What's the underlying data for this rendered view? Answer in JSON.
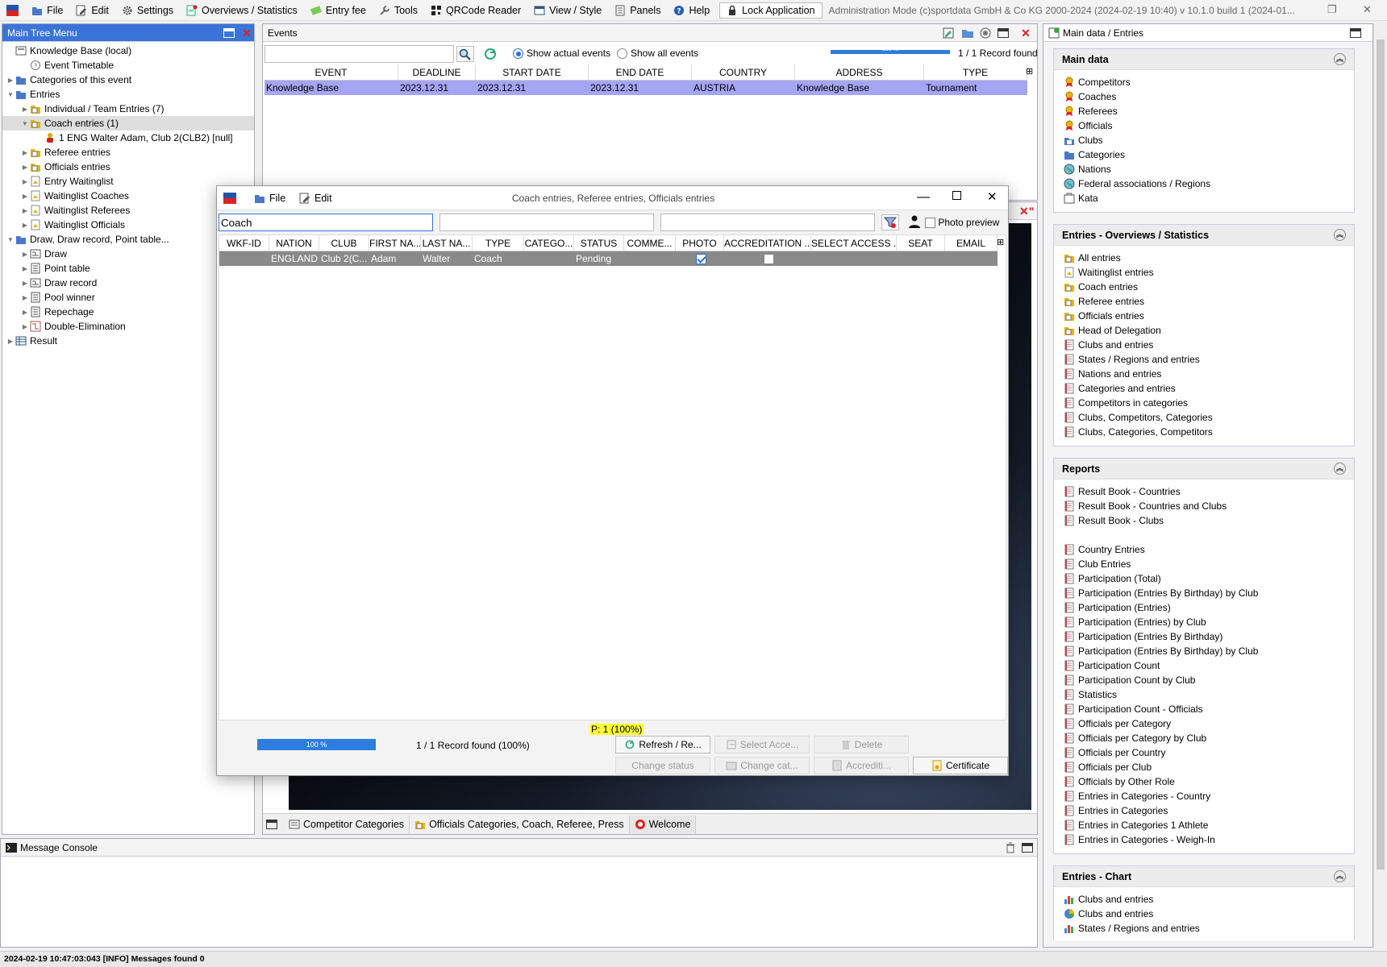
{
  "menubar": {
    "items": [
      {
        "label": "File",
        "icon": "folder-icon"
      },
      {
        "label": "Edit",
        "icon": "edit-icon"
      },
      {
        "label": "Settings",
        "icon": "gear-icon"
      },
      {
        "label": "Overviews / Statistics",
        "icon": "overview-icon"
      },
      {
        "label": "Entry fee",
        "icon": "money-icon"
      },
      {
        "label": "Tools",
        "icon": "tools-icon"
      },
      {
        "label": "QRCode Reader",
        "icon": "qrcode-icon"
      },
      {
        "label": "View / Style",
        "icon": "view-icon"
      },
      {
        "label": "Panels",
        "icon": "panels-icon"
      },
      {
        "label": "Help",
        "icon": "help-icon"
      }
    ],
    "lock_label": "Lock Application",
    "status": "Administration Mode (c)sportdata GmbH & Co KG 2000-2024 (2024-02-19 10:40)  v 10.1.0 build 1 (2024-01..."
  },
  "tree": {
    "title": "Main Tree Menu",
    "items": [
      {
        "label": "Knowledge Base (local)",
        "indent": 0,
        "arrow": "",
        "icon": "database-icon"
      },
      {
        "label": "Event Timetable",
        "indent": 1,
        "arrow": "",
        "icon": "clock-icon"
      },
      {
        "label": "Categories of this event",
        "indent": 0,
        "arrow": "▶",
        "icon": "folder-icon"
      },
      {
        "label": "Entries",
        "indent": 0,
        "arrow": "▼",
        "icon": "folder-icon"
      },
      {
        "label": "Individual / Team Entries (7)",
        "indent": 1,
        "arrow": "▶",
        "icon": "entries-folder-icon"
      },
      {
        "label": "Coach entries (1)",
        "indent": 1,
        "arrow": "▼",
        "icon": "entries-folder-icon",
        "selected": true
      },
      {
        "label": "1 ENG Walter Adam, Club 2(CLB2) [null]",
        "indent": 2,
        "arrow": "",
        "icon": "person-icon"
      },
      {
        "label": "Referee entries",
        "indent": 1,
        "arrow": "▶",
        "icon": "entries-folder-icon"
      },
      {
        "label": "Officials entries",
        "indent": 1,
        "arrow": "▶",
        "icon": "entries-folder-icon"
      },
      {
        "label": "Entry Waitinglist",
        "indent": 1,
        "arrow": "▶",
        "icon": "document-icon"
      },
      {
        "label": "Waitinglist Coaches",
        "indent": 1,
        "arrow": "▶",
        "icon": "document-icon"
      },
      {
        "label": "Waitinglist Referees",
        "indent": 1,
        "arrow": "▶",
        "icon": "document-icon"
      },
      {
        "label": "Waitinglist Officials",
        "indent": 1,
        "arrow": "▶",
        "icon": "document-icon"
      },
      {
        "label": "Draw, Draw record, Point table...",
        "indent": 0,
        "arrow": "▼",
        "icon": "folder-icon"
      },
      {
        "label": "Draw",
        "indent": 1,
        "arrow": "▶",
        "icon": "draw-icon"
      },
      {
        "label": "Point table",
        "indent": 1,
        "arrow": "▶",
        "icon": "list-icon"
      },
      {
        "label": "Draw record",
        "indent": 1,
        "arrow": "▶",
        "icon": "draw-icon"
      },
      {
        "label": "Pool winner",
        "indent": 1,
        "arrow": "▶",
        "icon": "list-icon"
      },
      {
        "label": "Repechage",
        "indent": 1,
        "arrow": "▶",
        "icon": "list-icon"
      },
      {
        "label": "Double-Elimination",
        "indent": 1,
        "arrow": "▶",
        "icon": "bracket-icon"
      },
      {
        "label": "Result",
        "indent": 0,
        "arrow": "▶",
        "icon": "table-icon"
      }
    ]
  },
  "events": {
    "title": "Events",
    "search_value": "",
    "radio_actual": "Show actual events",
    "radio_all": "Show all events",
    "progress_label": "100 %",
    "progress": 1.0,
    "record_found": "1 / 1 Record found",
    "columns": [
      "EVENT",
      "DEADLINE",
      "START DATE",
      "END DATE",
      "COUNTRY",
      "ADDRESS",
      "TYPE"
    ],
    "rows": [
      [
        "Knowledge Base",
        "2023.12.31",
        "2023.12.31",
        "2023.12.31",
        "AUSTRIA",
        "Knowledge Base",
        "Tournament"
      ]
    ]
  },
  "dialog": {
    "menu_file": "File",
    "menu_edit": "Edit",
    "title": "Coach entries, Referee entries, Officials entries",
    "filter1": "Coach",
    "filter2": "",
    "filter3": "",
    "photo_preview": "Photo preview",
    "columns": [
      "WKF-ID",
      "NATION",
      "CLUB",
      "FIRST NA...",
      "LAST NA...",
      "TYPE",
      "CATEGO...",
      "STATUS",
      "COMME...",
      "PHOTO",
      "ACCREDITATION ...",
      "SELECT ACCESS ...",
      "SEAT",
      "EMAIL"
    ],
    "rows": [
      {
        "wkf_id": "",
        "nation": "ENGLAND",
        "club": "Club 2(C...",
        "first_name": "Adam",
        "last_name": "Walter",
        "type": "Coach",
        "category": "",
        "status": "Pending",
        "comment": "",
        "photo": true,
        "accreditation": false,
        "select_access": "",
        "seat": "",
        "email": ""
      }
    ],
    "p_badge": "P: 1 (100%)",
    "progress_label": "100 %",
    "progress": 1.0,
    "record_found": "1 / 1 Record found (100%)",
    "buttons": {
      "refresh": "Refresh / Re...",
      "select_access": "Select Acce...",
      "delete": "Delete",
      "change_status": "Change status",
      "change_category": "Change cat...",
      "accreditation": "Accrediti...",
      "certificate": "Certificate"
    }
  },
  "bottom_tabs": [
    {
      "label": "Competitor Categories",
      "icon": "category-tab-icon"
    },
    {
      "label": "Officials Categories, Coach, Referee, Press",
      "icon": "officials-tab-icon"
    },
    {
      "label": "Welcome",
      "icon": "welcome-icon"
    }
  ],
  "console": {
    "title": "Message Console",
    "status": "2024-02-19 10:47:03:043 [INFO] Messages found 0"
  },
  "right_panel": {
    "title": "Main data / Entries",
    "sections": [
      {
        "title": "Main data",
        "items": [
          {
            "label": "Competitors",
            "icon": "medal-icon"
          },
          {
            "label": "Coaches",
            "icon": "medal-icon"
          },
          {
            "label": "Referees",
            "icon": "medal-icon"
          },
          {
            "label": "Officials",
            "icon": "medal-icon"
          },
          {
            "label": "Clubs",
            "icon": "club-icon"
          },
          {
            "label": "Categories",
            "icon": "folder-icon"
          },
          {
            "label": "Nations",
            "icon": "globe-icon"
          },
          {
            "label": "Federal associations / Regions",
            "icon": "globe-icon"
          },
          {
            "label": "Kata",
            "icon": "kata-icon"
          }
        ]
      },
      {
        "title": "Entries - Overviews / Statistics",
        "items": [
          {
            "label": "All entries",
            "icon": "entries-folder-icon"
          },
          {
            "label": "Waitinglist entries",
            "icon": "document-icon"
          },
          {
            "label": "Coach entries",
            "icon": "entries-folder-icon"
          },
          {
            "label": "Referee entries",
            "icon": "entries-folder-icon"
          },
          {
            "label": "Officials entries",
            "icon": "entries-folder-icon"
          },
          {
            "label": "Head of Delegation",
            "icon": "entries-folder-icon"
          },
          {
            "label": "Clubs and entries",
            "icon": "report-icon"
          },
          {
            "label": "States / Regions and entries",
            "icon": "report-icon"
          },
          {
            "label": "Nations and entries",
            "icon": "report-icon"
          },
          {
            "label": "Categories and entries",
            "icon": "report-icon"
          },
          {
            "label": "Competitors in categories",
            "icon": "report-icon"
          },
          {
            "label": "Clubs, Competitors, Categories",
            "icon": "report-icon"
          },
          {
            "label": "Clubs, Categories, Competitors",
            "icon": "report-icon"
          }
        ]
      },
      {
        "title": "Reports",
        "items": [
          {
            "label": "Result Book - Countries",
            "icon": "report-icon"
          },
          {
            "label": "Result Book - Countries and Clubs",
            "icon": "report-icon"
          },
          {
            "label": "Result Book - Clubs",
            "icon": "report-icon"
          },
          {
            "label": "",
            "icon": ""
          },
          {
            "label": "Country Entries",
            "icon": "report-icon"
          },
          {
            "label": "Club Entries",
            "icon": "report-icon"
          },
          {
            "label": "Participation (Total)",
            "icon": "report-icon"
          },
          {
            "label": "Participation (Entries By Birthday) by Club",
            "icon": "report-icon"
          },
          {
            "label": "Participation (Entries)",
            "icon": "report-icon"
          },
          {
            "label": "Participation (Entries) by Club",
            "icon": "report-icon"
          },
          {
            "label": "Participation (Entries By Birthday)",
            "icon": "report-icon"
          },
          {
            "label": "Participation (Entries By Birthday) by Club",
            "icon": "report-icon"
          },
          {
            "label": "Participation Count",
            "icon": "report-icon"
          },
          {
            "label": "Participation Count by Club",
            "icon": "report-icon"
          },
          {
            "label": "Statistics",
            "icon": "report-icon"
          },
          {
            "label": "Participation Count - Officials",
            "icon": "report-icon"
          },
          {
            "label": "Officials per Category",
            "icon": "report-icon"
          },
          {
            "label": "Officials per Category by Club",
            "icon": "report-icon"
          },
          {
            "label": "Officials per Country",
            "icon": "report-icon"
          },
          {
            "label": "Officials per Club",
            "icon": "report-icon"
          },
          {
            "label": "Officials by Other Role",
            "icon": "report-icon"
          },
          {
            "label": "Entries in Categories - Country",
            "icon": "report-icon"
          },
          {
            "label": "Entries in Categories",
            "icon": "report-icon"
          },
          {
            "label": "Entries in Categories 1 Athlete",
            "icon": "report-icon"
          },
          {
            "label": "Entries in Categories - Weigh-In",
            "icon": "report-icon"
          }
        ]
      },
      {
        "title": "Entries - Chart",
        "items": [
          {
            "label": "Clubs and entries",
            "icon": "bar-chart-icon"
          },
          {
            "label": "Clubs and entries",
            "icon": "pie-chart-icon"
          },
          {
            "label": "States / Regions and entries",
            "icon": "bar-chart-icon"
          }
        ]
      }
    ]
  },
  "colors": {
    "selection": "#a5a5f5",
    "dialog_selection": "#8a8a8a",
    "progress": "#2b7de0",
    "accent_red": "#e02020",
    "badge_yellow": "#ffff33"
  }
}
